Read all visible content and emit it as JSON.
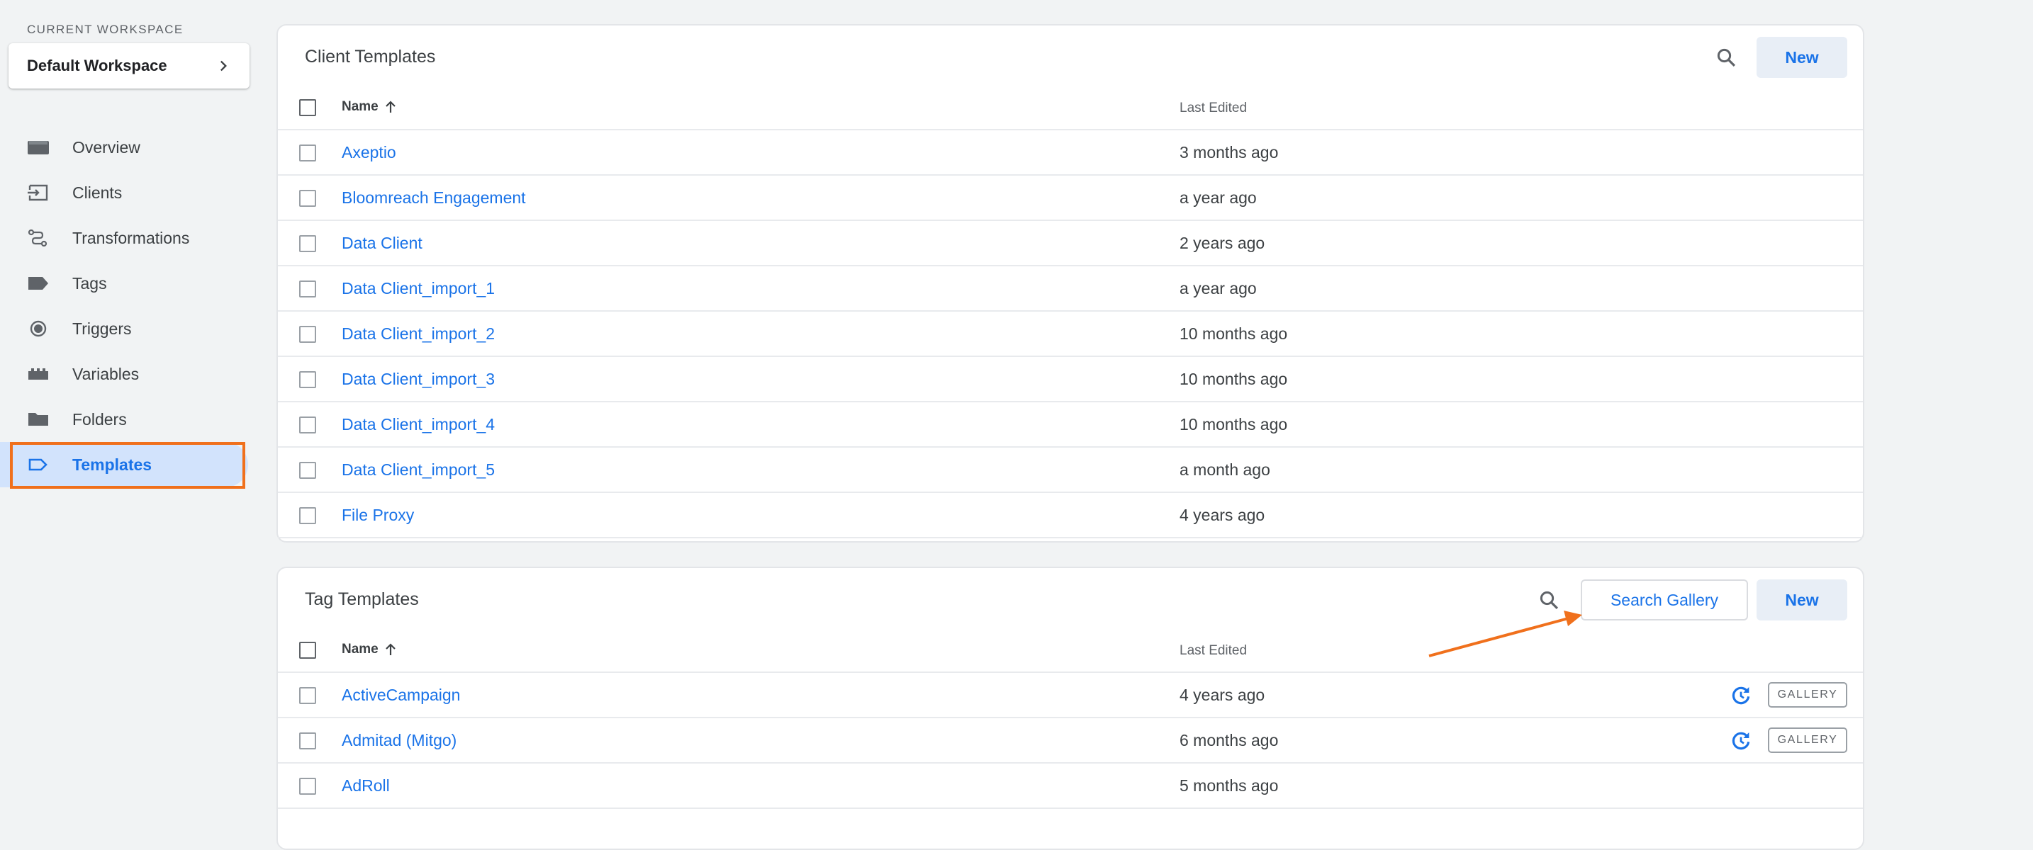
{
  "sidebar": {
    "workspace_label": "CURRENT WORKSPACE",
    "workspace_name": "Default Workspace",
    "items": [
      {
        "label": "Overview",
        "icon": "overview-icon"
      },
      {
        "label": "Clients",
        "icon": "clients-icon"
      },
      {
        "label": "Transformations",
        "icon": "transformations-icon"
      },
      {
        "label": "Tags",
        "icon": "tag-icon"
      },
      {
        "label": "Triggers",
        "icon": "trigger-icon"
      },
      {
        "label": "Variables",
        "icon": "variables-icon"
      },
      {
        "label": "Folders",
        "icon": "folder-icon"
      },
      {
        "label": "Templates",
        "icon": "templates-icon",
        "active": true
      }
    ]
  },
  "client_templates": {
    "title": "Client Templates",
    "new_label": "New",
    "columns": {
      "name": "Name",
      "last_edited": "Last Edited"
    },
    "rows": [
      {
        "name": "Axeptio",
        "last_edited": "3 months ago"
      },
      {
        "name": "Bloomreach Engagement",
        "last_edited": "a year ago"
      },
      {
        "name": "Data Client",
        "last_edited": "2 years ago"
      },
      {
        "name": "Data Client_import_1",
        "last_edited": "a year ago"
      },
      {
        "name": "Data Client_import_2",
        "last_edited": "10 months ago"
      },
      {
        "name": "Data Client_import_3",
        "last_edited": "10 months ago"
      },
      {
        "name": "Data Client_import_4",
        "last_edited": "10 months ago"
      },
      {
        "name": "Data Client_import_5",
        "last_edited": "a month ago"
      },
      {
        "name": "File Proxy",
        "last_edited": "4 years ago"
      }
    ]
  },
  "tag_templates": {
    "title": "Tag Templates",
    "search_gallery_label": "Search Gallery",
    "new_label": "New",
    "columns": {
      "name": "Name",
      "last_edited": "Last Edited"
    },
    "rows": [
      {
        "name": "ActiveCampaign",
        "last_edited": "4 years ago",
        "badge": "GALLERY"
      },
      {
        "name": "Admitad (Mitgo)",
        "last_edited": "6 months ago",
        "badge": "GALLERY"
      },
      {
        "name": "AdRoll",
        "last_edited": "5 months ago"
      }
    ]
  },
  "colors": {
    "accent": "#1a73e8",
    "active_bg": "#d2e3fc",
    "highlight": "#f0701c",
    "background": "#f1f3f4"
  }
}
